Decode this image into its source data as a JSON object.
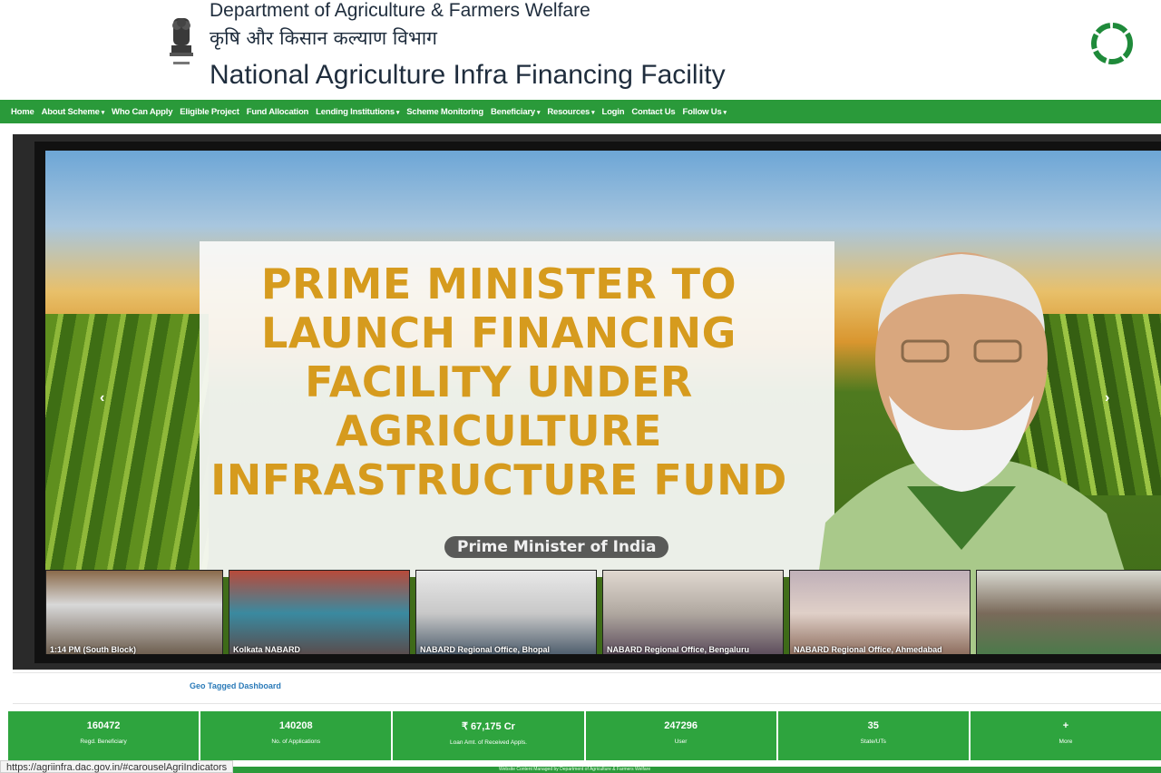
{
  "header": {
    "dept_en": "Department of Agriculture & Farmers Welfare",
    "dept_hi": "कृषि और किसान कल्याण विभाग",
    "site_title": "National Agriculture Infra Financing Facility"
  },
  "nav": {
    "items": [
      {
        "label": "Home",
        "caret": ""
      },
      {
        "label": "About Scheme",
        "caret": "▾"
      },
      {
        "label": "Who Can Apply",
        "caret": ""
      },
      {
        "label": "Eligible Project",
        "caret": ""
      },
      {
        "label": "Fund Allocation",
        "caret": ""
      },
      {
        "label": "Lending Institutions",
        "caret": "▾"
      },
      {
        "label": "Scheme Monitoring",
        "caret": ""
      },
      {
        "label": "Beneficiary",
        "caret": "▾"
      },
      {
        "label": "Resources",
        "caret": "▾"
      },
      {
        "label": "Login",
        "caret": ""
      },
      {
        "label": "Contact Us",
        "caret": ""
      },
      {
        "label": "Follow Us",
        "caret": "▾"
      }
    ]
  },
  "carousel": {
    "headline": "PRIME MINISTER TO LAUNCH FINANCING FACILITY UNDER AGRICULTURE INFRASTRUCTURE FUND",
    "caption": "Prime Minister of India",
    "prev_arrow": "‹",
    "next_arrow": "›",
    "thumbnails": [
      {
        "label": "1:14 PM (South Block)"
      },
      {
        "label": "Kolkata NABARD"
      },
      {
        "label": "NABARD Regional Office, Bhopal"
      },
      {
        "label": "NABARD Regional Office, Bengaluru"
      },
      {
        "label": "NABARD Regional Office, Ahmedabad"
      },
      {
        "label": ""
      }
    ]
  },
  "geo_link": "Geo Tagged Dashboard",
  "stats": [
    {
      "value": "160472",
      "label": "Regd. Beneficiary"
    },
    {
      "value": "140208",
      "label": "No. of Applications"
    },
    {
      "value": "₹ 67,175 Cr",
      "label": "Loan Amt. of Received Appls."
    },
    {
      "value": "247296",
      "label": "User"
    },
    {
      "value": "35",
      "label": "State/UTs"
    },
    {
      "value": "+",
      "label": "More"
    }
  ],
  "footer": "Website Content Managed by Department of Agriculture & Farmers Welfare",
  "status_url": "https://agriinfra.dac.gov.in/#carouselAgriIndicators",
  "colors": {
    "nav_green": "#2a9a3a",
    "stat_green": "#2ea43e",
    "headline_gold": "#d69b1e",
    "logo_green": "#1f8a3a"
  }
}
